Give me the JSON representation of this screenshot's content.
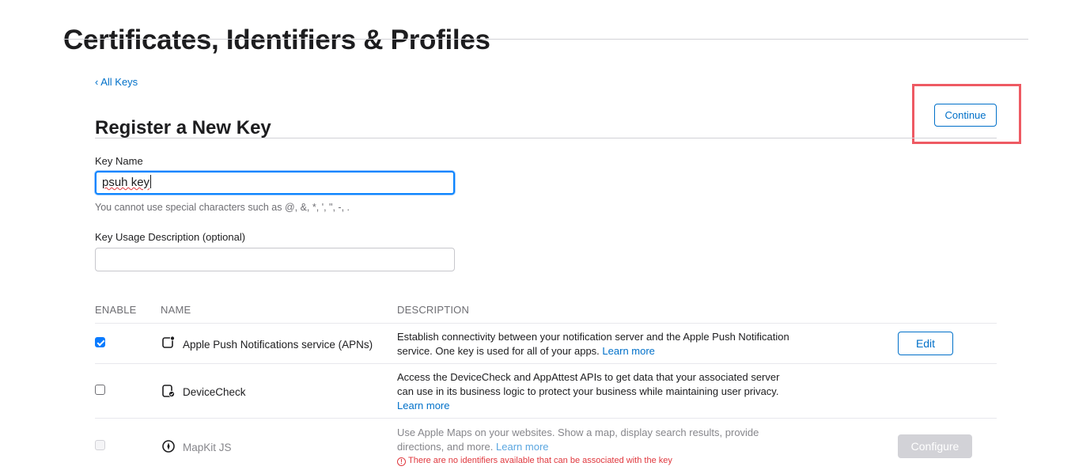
{
  "header": {
    "title": "Certificates, Identifiers & Profiles"
  },
  "nav": {
    "back_label": "‹ All Keys"
  },
  "form": {
    "title": "Register a New Key",
    "continue_label": "Continue",
    "key_name": {
      "label": "Key Name",
      "value": "psuh key",
      "hint": "You cannot use special characters such as @, &, *, ', \", -, ."
    },
    "description": {
      "label": "Key Usage Description (optional)",
      "value": "",
      "placeholder": ""
    }
  },
  "table": {
    "columns": [
      "ENABLE",
      "NAME",
      "DESCRIPTION"
    ],
    "rows": [
      {
        "enabled": true,
        "icon": "push-notification-icon",
        "name": "Apple Push Notifications service (APNs)",
        "description": "Establish connectivity between your notification server and the Apple Push Notification service. One key is used for all of your apps.",
        "learn_more": "Learn more",
        "action": "Edit"
      },
      {
        "enabled": false,
        "icon": "devicecheck-icon",
        "name": "DeviceCheck",
        "description": "Access the DeviceCheck and AppAttest APIs to get data that your associated server can use in its business logic to protect your business while maintaining user privacy.",
        "learn_more": "Learn more"
      },
      {
        "enabled": false,
        "disabled": true,
        "icon": "mapkit-compass-icon",
        "name": "MapKit JS",
        "description": "Use Apple Maps on your websites. Show a map, display search results, provide directions, and more.",
        "learn_more": "Learn more",
        "warning": "There are no identifiers available that can be associated with the key",
        "action": "Configure"
      }
    ]
  },
  "colors": {
    "accent": "#0070c9",
    "highlight_box": "#ee5a63",
    "warning": "#e0383e"
  }
}
